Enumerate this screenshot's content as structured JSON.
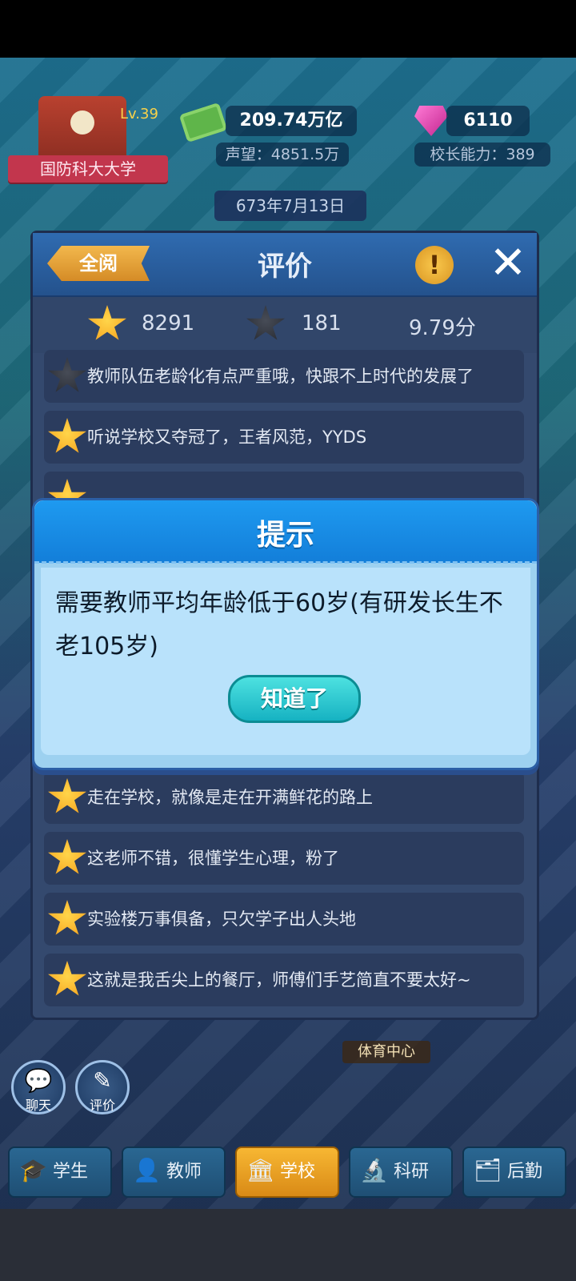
{
  "hud": {
    "school_name": "国防科大大学",
    "level": "Lv.39",
    "money": "209.74万亿",
    "reputation": "声望：4851.5万",
    "gems": "6110",
    "principal_ability": "校长能力：389",
    "date": "673年7月13日"
  },
  "review_panel": {
    "read_all_label": "全阅",
    "title": "评价",
    "stats": {
      "positive_count": "8291",
      "negative_count": "181",
      "score": "9.79分"
    },
    "reviews": [
      {
        "sentiment": "negative",
        "text": "教师队伍老龄化有点严重哦，快跟不上时代的发展了"
      },
      {
        "sentiment": "positive",
        "text": "听说学校又夺冠了，王者风范，YYDS"
      },
      {
        "sentiment": "positive",
        "text": "走在学校，就像是走在开满鲜花的路上"
      },
      {
        "sentiment": "positive",
        "text": "这老师不错，很懂学生心理，粉了"
      },
      {
        "sentiment": "positive",
        "text": "实验楼万事俱备，只欠学子出人头地"
      },
      {
        "sentiment": "positive",
        "text": "这就是我舌尖上的餐厅，师傅们手艺简直不要太好~"
      }
    ]
  },
  "dialog": {
    "title": "提示",
    "message": "需要教师平均年龄低于60岁(有研发长生不老105岁)",
    "ok_label": "知道了"
  },
  "map": {
    "stadium_label": "体育中心"
  },
  "side_buttons": {
    "chat_label": "聊天",
    "review_label": "评价"
  },
  "bottom_nav": {
    "tabs": [
      {
        "label": "学生",
        "icon": "graduation-cap-icon",
        "active": false
      },
      {
        "label": "教师",
        "icon": "teacher-icon",
        "active": false
      },
      {
        "label": "学校",
        "icon": "school-building-icon",
        "active": true
      },
      {
        "label": "科研",
        "icon": "microscope-icon",
        "active": false
      },
      {
        "label": "后勤",
        "icon": "logistics-icon",
        "active": false
      }
    ]
  },
  "colors": {
    "accent_blue": "#1e9af0",
    "gold": "#f7b733",
    "teal_button": "#16b2c2"
  }
}
